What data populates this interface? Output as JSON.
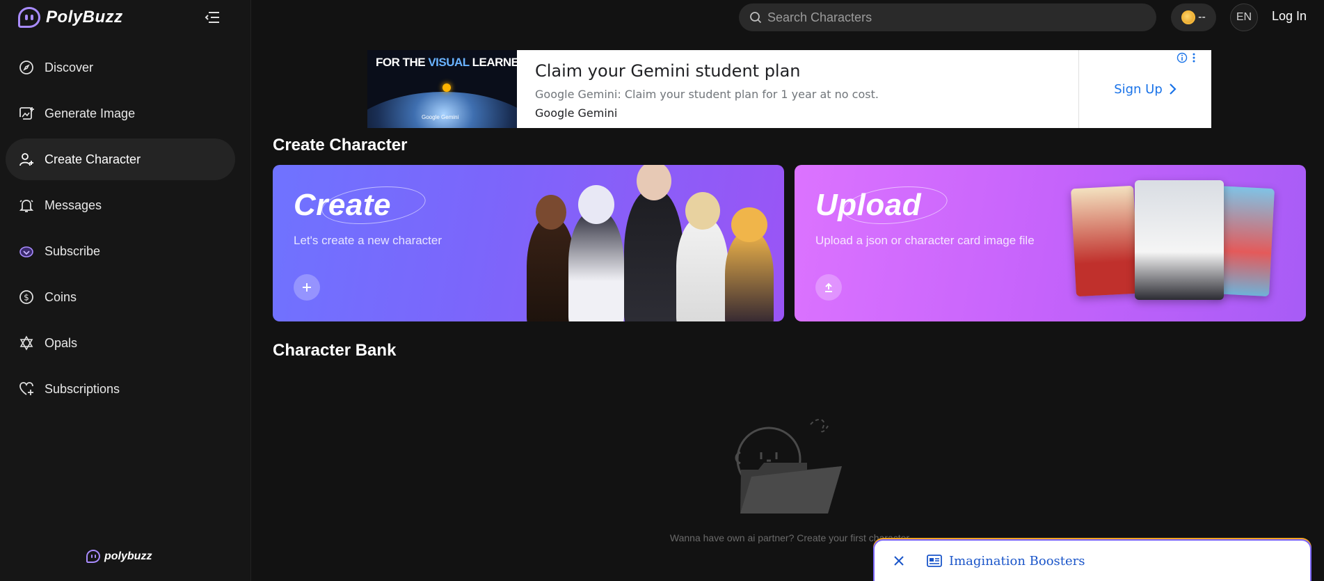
{
  "app": {
    "name": "PolyBuzz",
    "footer_name": "polybuzz"
  },
  "sidebar": {
    "items": [
      {
        "label": "Discover",
        "icon": "compass-icon",
        "active": false
      },
      {
        "label": "Generate Image",
        "icon": "image-plus-icon",
        "active": false
      },
      {
        "label": "Create Character",
        "icon": "user-plus-icon",
        "active": true
      },
      {
        "label": "Messages",
        "icon": "bell-icon",
        "active": false
      },
      {
        "label": "Subscribe",
        "icon": "crown-icon",
        "active": false
      },
      {
        "label": "Coins",
        "icon": "dollar-coin-icon",
        "active": false
      },
      {
        "label": "Opals",
        "icon": "star-of-david-icon",
        "active": false
      },
      {
        "label": "Subscriptions",
        "icon": "heart-plus-icon",
        "active": false
      }
    ]
  },
  "topbar": {
    "search_placeholder": "Search Characters",
    "coin_value": "--",
    "language": "EN",
    "login_label": "Log In"
  },
  "ad": {
    "image_headline_prefix": "FOR THE ",
    "image_headline_highlight": "VISUAL",
    "image_headline_suffix": " LEARNER",
    "image_brand": "Google Gemini",
    "title": "Claim your Gemini student plan",
    "description": "Google Gemini: Claim your student plan for 1 year at no cost.",
    "advertiser": "Google Gemini",
    "cta": "Sign Up"
  },
  "create_section": {
    "title": "Create Character",
    "create_card": {
      "title": "Create",
      "subtitle": "Let's create a new character"
    },
    "upload_card": {
      "title": "Upload",
      "subtitle": "Upload a json or character card image file"
    }
  },
  "bank_section": {
    "title": "Character Bank",
    "empty_text": "Wanna have own ai partner? Create your first character"
  },
  "banner": {
    "label": "Imagination Boosters"
  },
  "colors": {
    "background": "#121212",
    "sidebar": "#161616",
    "accent": "#a98cff",
    "create_gradient_start": "#6f73ff",
    "upload_gradient_start": "#dc73ff",
    "ad_link": "#1a73e8"
  }
}
